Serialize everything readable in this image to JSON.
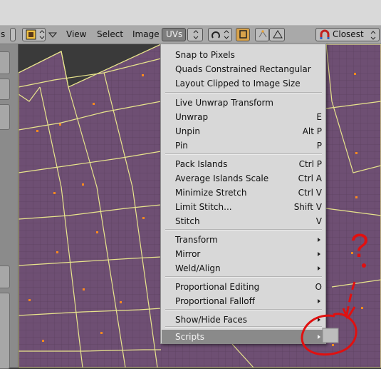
{
  "toolbar": {
    "view_label": "View",
    "select_label": "Select",
    "image_label": "Image",
    "uvs_label": "UVs",
    "snap_mode_label": "Closest",
    "left_label": "s"
  },
  "uvs_menu": {
    "groups": [
      {
        "items": [
          {
            "label": "Snap to Pixels",
            "shortcut": "",
            "submenu": false
          },
          {
            "label": "Quads Constrained Rectangular",
            "shortcut": "",
            "submenu": false
          },
          {
            "label": "Layout Clipped to Image Size",
            "shortcut": "",
            "submenu": false
          }
        ]
      },
      {
        "items": [
          {
            "label": "Live Unwrap Transform",
            "shortcut": "",
            "submenu": false
          },
          {
            "label": "Unwrap",
            "shortcut": "E",
            "submenu": false
          },
          {
            "label": "Unpin",
            "shortcut": "Alt P",
            "submenu": false
          },
          {
            "label": "Pin",
            "shortcut": "P",
            "submenu": false
          }
        ]
      },
      {
        "items": [
          {
            "label": "Pack Islands",
            "shortcut": "Ctrl P",
            "submenu": false
          },
          {
            "label": "Average Islands Scale",
            "shortcut": "Ctrl A",
            "submenu": false
          },
          {
            "label": "Minimize Stretch",
            "shortcut": "Ctrl V",
            "submenu": false
          },
          {
            "label": "Limit Stitch...",
            "shortcut": "Shift V",
            "submenu": false
          },
          {
            "label": "Stitch",
            "shortcut": "V",
            "submenu": false
          }
        ]
      },
      {
        "items": [
          {
            "label": "Transform",
            "shortcut": "",
            "submenu": true
          },
          {
            "label": "Mirror",
            "shortcut": "",
            "submenu": true
          },
          {
            "label": "Weld/Align",
            "shortcut": "",
            "submenu": true
          }
        ]
      },
      {
        "items": [
          {
            "label": "Proportional Editing",
            "shortcut": "O",
            "submenu": false
          },
          {
            "label": "Proportional Falloff",
            "shortcut": "",
            "submenu": true
          }
        ]
      },
      {
        "items": [
          {
            "label": "Show/Hide Faces",
            "shortcut": "",
            "submenu": true
          }
        ]
      },
      {
        "items": [
          {
            "label": "Scripts",
            "shortcut": "",
            "submenu": true,
            "highlighted": true
          }
        ]
      }
    ]
  },
  "annotation": {
    "mark": "?",
    "color": "#e01010"
  },
  "colors": {
    "mesh_face": "#6e4f73",
    "mesh_edge": "#e8e48c",
    "vertex": "#ff8a1e",
    "menu_bg": "#d8d8d8",
    "highlight": "#8a8a8a"
  }
}
